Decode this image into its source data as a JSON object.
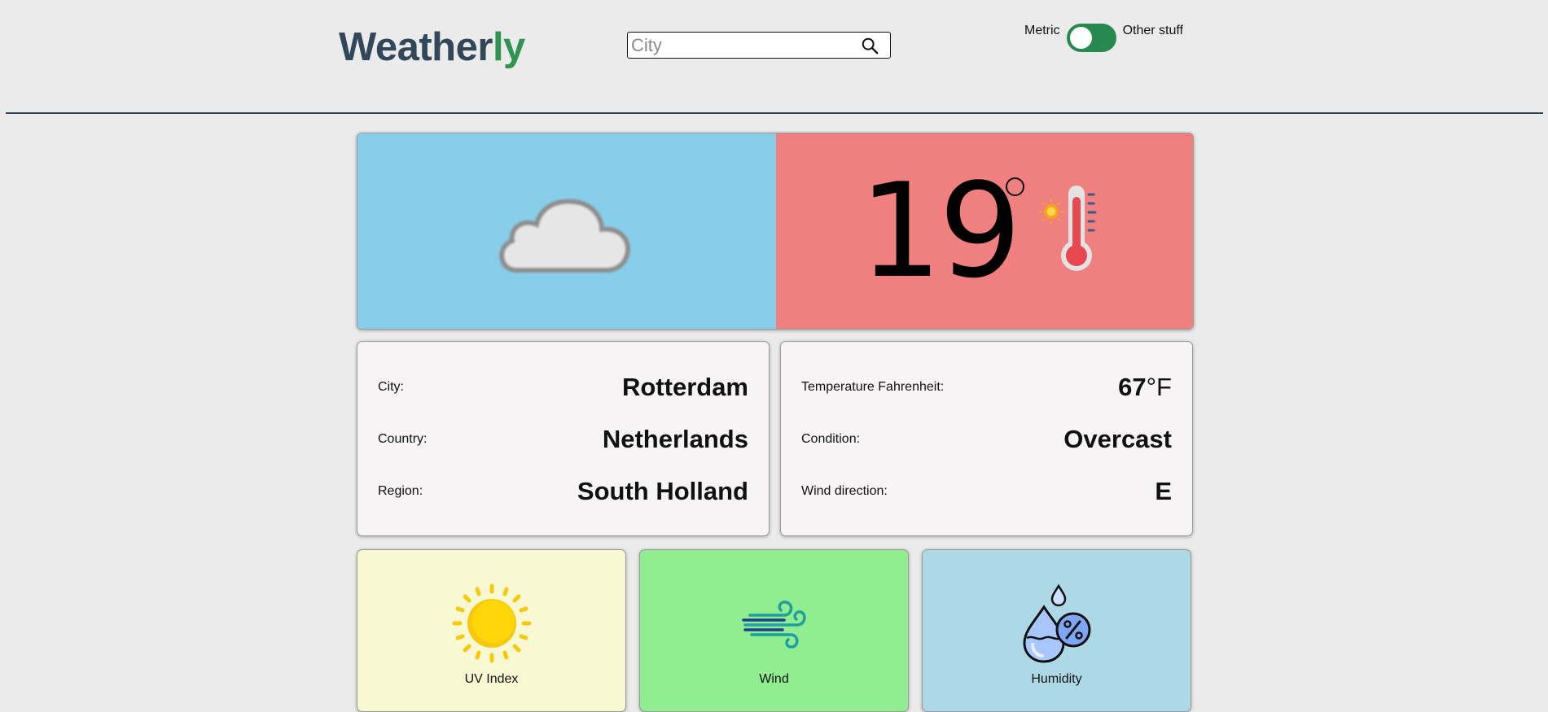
{
  "header": {
    "brand_part1": "Weather",
    "brand_part2": "ly",
    "search_placeholder": "City",
    "units_left_label": "Metric",
    "units_right_label": "Other stuff"
  },
  "hero": {
    "temperature": "19",
    "condition_icon": "cloud-icon",
    "temperature_icon": "thermometer-sun-icon"
  },
  "location": {
    "city_label": "City:",
    "city_value": "Rotterdam",
    "country_label": "Country:",
    "country_value": "Netherlands",
    "region_label": "Region:",
    "region_value": "South Holland"
  },
  "conditions": {
    "fahrenheit_label": "Temperature Fahrenheit:",
    "fahrenheit_value": "67",
    "fahrenheit_unit": "°F",
    "condition_label": "Condition:",
    "condition_value": "Overcast",
    "wind_dir_label": "Wind direction:",
    "wind_dir_value": "E"
  },
  "tiles": [
    {
      "label": "UV Index",
      "icon": "sun-icon"
    },
    {
      "label": "Wind",
      "icon": "wind-icon"
    },
    {
      "label": "Humidity",
      "icon": "humidity-icon"
    }
  ],
  "colors": {
    "brand_dark": "#33475b",
    "brand_accent": "#2f9450",
    "hero_left": "#87ceeb",
    "hero_right": "#f07f7f",
    "uv_tile": "#f8f9d2",
    "wind_tile": "#90ee90",
    "humidity_tile": "#add8e6"
  }
}
